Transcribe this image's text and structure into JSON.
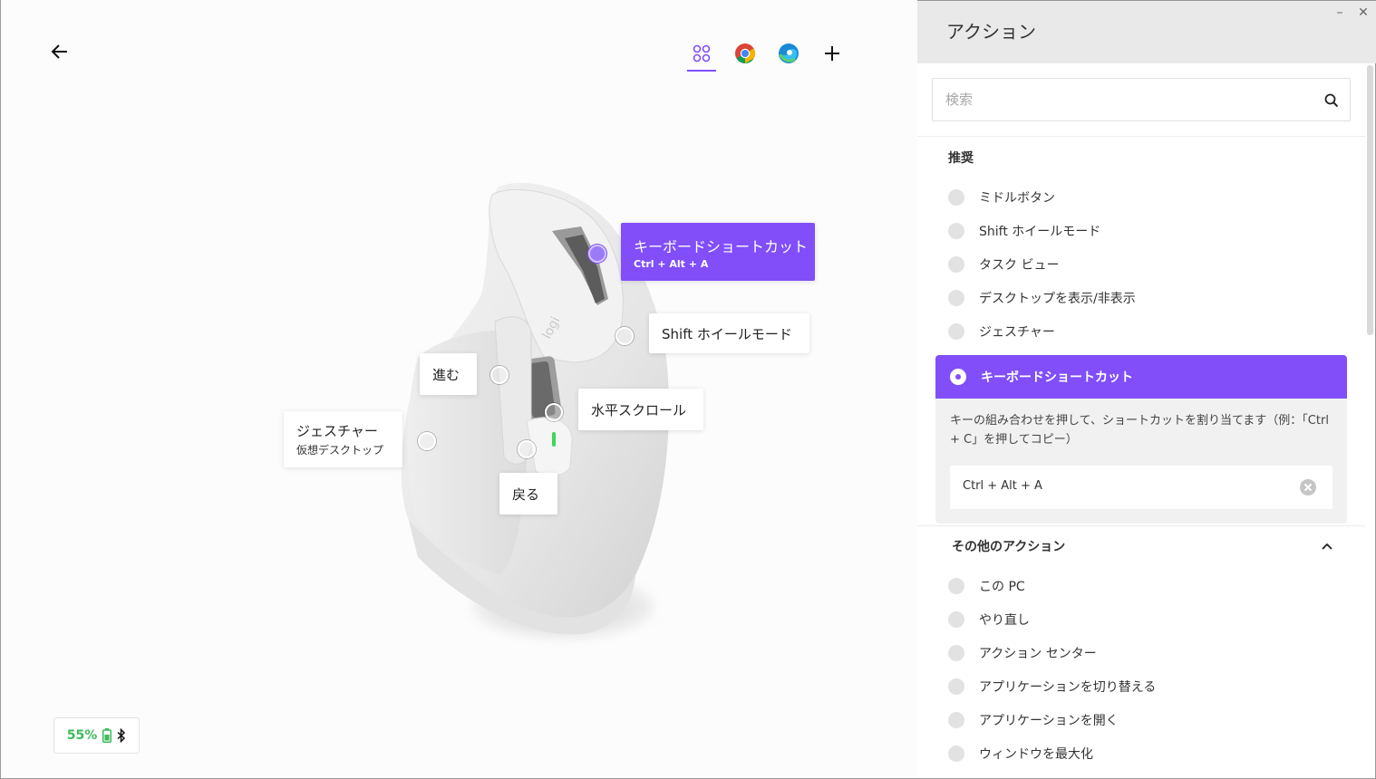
{
  "header": {
    "back_label": "←",
    "apps": [
      {
        "name": "all-apps"
      },
      {
        "name": "chrome"
      },
      {
        "name": "edge"
      },
      {
        "name": "add-app"
      }
    ]
  },
  "callouts": {
    "keyboard_shortcut": {
      "main": "キーボードショートカット",
      "sub": "Ctrl + Alt + A"
    },
    "shift_wheel": {
      "main": "Shift ホイールモード"
    },
    "forward": {
      "main": "進む"
    },
    "horizontal_scroll": {
      "main": "水平スクロール"
    },
    "gesture": {
      "main": "ジェスチャー",
      "sub": "仮想デスクトップ"
    },
    "back": {
      "main": "戻る"
    }
  },
  "device": {
    "battery": "55%"
  },
  "panel": {
    "title": "アクション",
    "minimize": "–",
    "close": "✕",
    "search_placeholder": "検索",
    "recommended_title": "推奨",
    "recommended": [
      "ミドルボタン",
      "Shift ホイールモード",
      "タスク ビュー",
      "デスクトップを表示/非表示",
      "ジェスチャー"
    ],
    "selected": {
      "label": "キーボードショートカット",
      "description": "キーの組み合わせを押して、ショートカットを割り当てます（例：「Ctrl + C」を押してコピー）",
      "value": "Ctrl + Alt + A"
    },
    "other_title": "その他のアクション",
    "other": [
      "この PC",
      "やり直し",
      "アクション センター",
      "アプリケーションを切り替える",
      "アプリケーションを開く",
      "ウィンドウを最大化"
    ]
  },
  "colors": {
    "accent": "#814efa",
    "battery": "#3dbb5a"
  }
}
